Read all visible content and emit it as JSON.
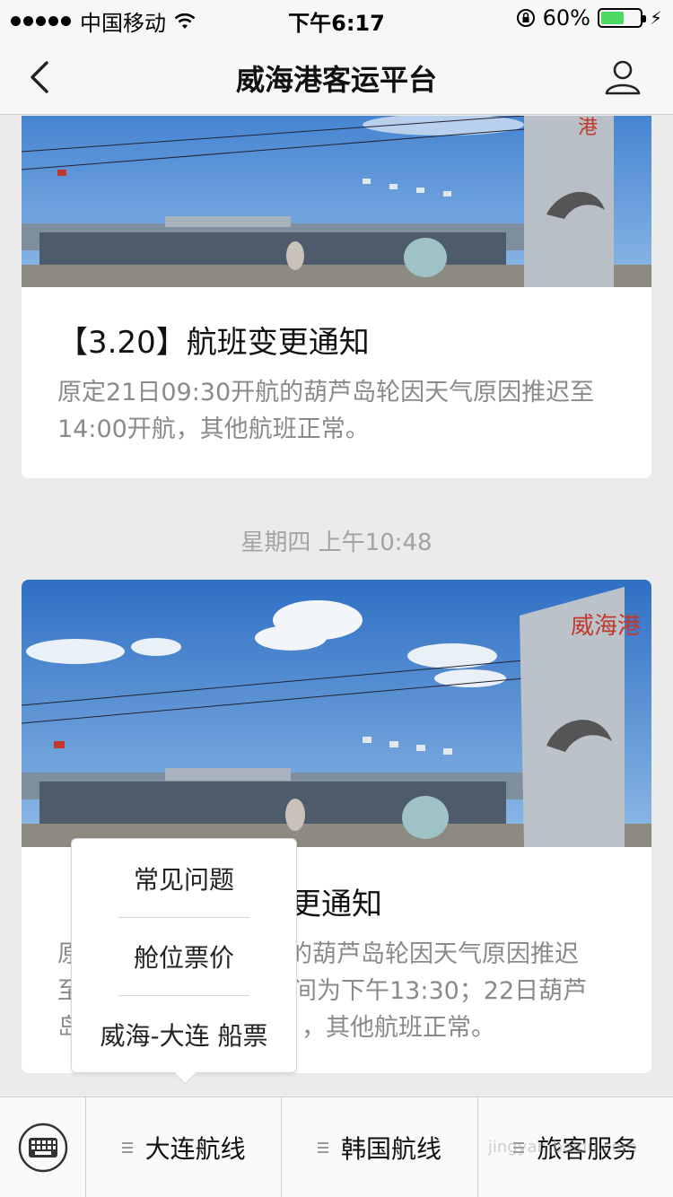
{
  "status_bar": {
    "carrier": "中国移动",
    "time": "下午6:17",
    "battery_percent": "60%",
    "battery_level": 0.6
  },
  "nav": {
    "title": "威海港客运平台",
    "back_icon": "chevron-left-icon",
    "profile_icon": "user-icon"
  },
  "messages": [
    {
      "title": "【3.20】航班变更通知",
      "description": "原定21日09:30开航的葫芦岛轮因天气原因推迟至14:00开航，其他航班正常。"
    },
    {
      "timestamp": "星期四 上午10:48",
      "title_visible": "更通知",
      "desc_line_1": "原",
      "desc_line_1_right": "的葫芦岛轮因天气原因推迟",
      "desc_line_2": "至",
      "desc_line_2_right": "间为下午13:30；22日葫芦",
      "desc_line_3": "岛",
      "desc_line_3_right": "，其他航班正常。"
    }
  ],
  "sign_text": "威海港",
  "popup_menu": {
    "items": [
      "常见问题",
      "舱位票价",
      "威海-大连 船票"
    ]
  },
  "menu_bar": {
    "keyboard_icon": "keyboard-icon",
    "tabs": [
      "大连航线",
      "韩国航线",
      "旅客服务"
    ]
  },
  "watermark": "jingyan.baidu.com",
  "colors": {
    "battery_green": "#4cd964",
    "secondary_text": "#8a8a8a",
    "background": "#ebebeb"
  }
}
